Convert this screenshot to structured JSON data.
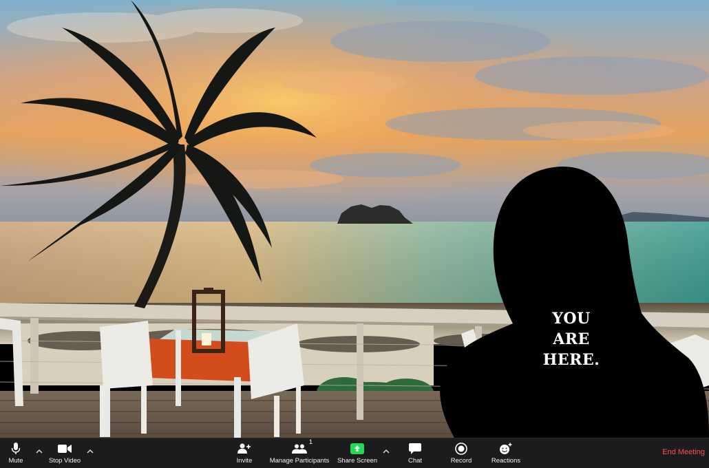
{
  "overlay": {
    "line1": "YOU",
    "line2": "ARE",
    "line3": "HERE."
  },
  "toolbar": {
    "mute_label": "Mute",
    "stop_video_label": "Stop Video",
    "invite_label": "Invite",
    "manage_participants_label": "Manage Participants",
    "participants_count": "1",
    "share_screen_label": "Share Screen",
    "chat_label": "Chat",
    "record_label": "Record",
    "reactions_label": "Reactions",
    "end_meeting_label": "End Meeting"
  },
  "colors": {
    "toolbar_bg": "#1c1c1e",
    "share_green": "#23d959",
    "end_meeting_red": "#ff4d4d"
  },
  "icons": {
    "mute": "microphone-icon",
    "video": "video-camera-icon",
    "invite": "add-person-icon",
    "participants": "people-icon",
    "share": "share-screen-arrow-icon",
    "chat": "chat-bubble-icon",
    "record": "record-icon",
    "reactions": "smiley-plus-icon"
  }
}
